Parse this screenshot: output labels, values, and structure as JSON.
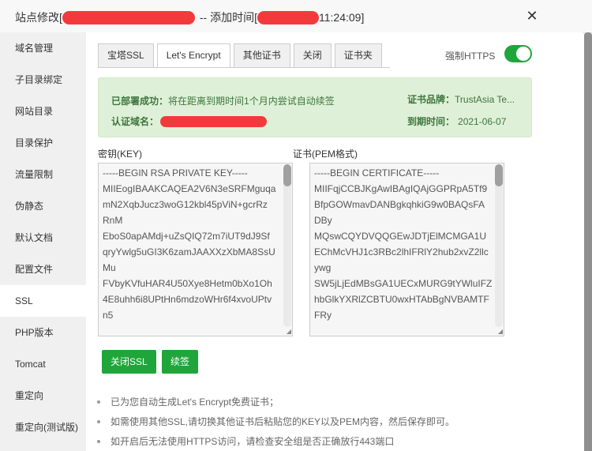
{
  "titlebar": {
    "prefix": "站点修改[",
    "middle": "-- 添加时间[",
    "suffix": " 11:24:09]",
    "close_icon": "close-x"
  },
  "sidebar": {
    "items": [
      {
        "label": "域名管理",
        "active": false
      },
      {
        "label": "子目录绑定",
        "active": false
      },
      {
        "label": "网站目录",
        "active": false
      },
      {
        "label": "目录保护",
        "active": false
      },
      {
        "label": "流量限制",
        "active": false
      },
      {
        "label": "伪静态",
        "active": false
      },
      {
        "label": "默认文档",
        "active": false
      },
      {
        "label": "配置文件",
        "active": false
      },
      {
        "label": "SSL",
        "active": true
      },
      {
        "label": "PHP版本",
        "active": false
      },
      {
        "label": "Tomcat",
        "active": false
      },
      {
        "label": "重定向",
        "active": false
      },
      {
        "label": "重定向(测试版)",
        "active": false
      }
    ]
  },
  "tabs": [
    {
      "label": "宝塔SSL",
      "active": false
    },
    {
      "label": "Let's Encrypt",
      "active": true
    },
    {
      "label": "其他证书",
      "active": false
    },
    {
      "label": "关闭",
      "active": false
    },
    {
      "label": "证书夹",
      "active": false
    }
  ],
  "force_https": {
    "label": "强制HTTPS",
    "enabled": true
  },
  "status": {
    "deployed_label": "已部署成功：",
    "deployed_text": "将在距离到期时间1个月内尝试自动续签",
    "domain_label": "认证域名：",
    "brand_label": "证书品牌：",
    "brand_value": "TrustAsia Te...",
    "expiry_label": "到期时间：",
    "expiry_value": "2021-06-07"
  },
  "key": {
    "label": "密钥(KEY)",
    "lines": [
      "-----BEGIN RSA PRIVATE KEY-----",
      "MIIEogIBAAKCAQEA2V6N3eSRFMguqa",
      "mN2XqbJucz3woG12kbl45pViN+gcrRz",
      "RnM",
      "EboS0apAMdj+uZsQIQ72m7iUT9dJ9Sf",
      "qryYwlg5uGI3K6zamJAAXXzXbMA8SsU",
      "Mu",
      "FVbyKVfuHAR4U50Xye8Hetm0bXo1Oh",
      "4E8uhh6i8UPtHn6mdzoWHr6f4xvoUPtv",
      "n5"
    ]
  },
  "cert": {
    "label": "证书(PEM格式)",
    "lines": [
      "-----BEGIN CERTIFICATE-----",
      "MIIFqjCCBJKgAwIBAgIQAjGGPRpA5Tf9",
      "BfpGOWmavDANBgkqhkiG9w0BAQsFA",
      "DBy",
      "MQswCQYDVQQGEwJDTjElMCMGA1U",
      "EChMcVHJ1c3RBc2lhIFRlY2hub2xvZ2llc",
      "ywg",
      "SW5jLjEdMBsGA1UECxMURG9tYWluIFZ",
      "hbGlkYXRlZCBTU0wxHTAbBgNVBAMTF",
      "FRy"
    ]
  },
  "buttons": {
    "close_ssl": "关闭SSL",
    "renew": "续签"
  },
  "notes": [
    "已为您自动生成Let's Encrypt免费证书；",
    "如需使用其他SSL,请切换其他证书后粘贴您的KEY以及PEM内容，然后保存即可。",
    "如开启后无法使用HTTPS访问，请检查安全组是否正确放行443端口"
  ],
  "colors": {
    "accent": "#20a53a",
    "alert_bg": "#dff0d8",
    "alert_text": "#3c763d",
    "redaction": "#f23a3c"
  }
}
